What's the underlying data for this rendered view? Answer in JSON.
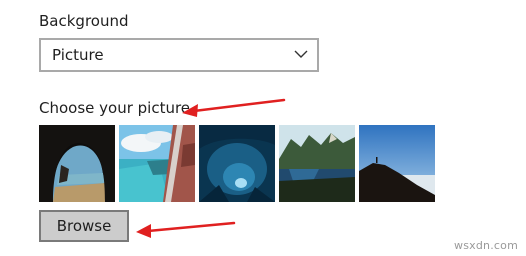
{
  "background_section": {
    "label": "Background",
    "selected_value": "Picture"
  },
  "picture_section": {
    "label": "Choose your picture",
    "thumbnails": [
      {
        "name": "cave-beach-picture"
      },
      {
        "name": "tropical-beach-window-picture"
      },
      {
        "name": "ice-cave-picture"
      },
      {
        "name": "mountain-lake-picture"
      },
      {
        "name": "cliff-sky-picture"
      }
    ]
  },
  "browse_button": {
    "label": "Browse"
  },
  "watermark": {
    "text": "wsxdn.com"
  },
  "colors": {
    "annotation_arrow": "#e02020",
    "button_bg": "#cccccc",
    "dropdown_border": "#a9a9a9"
  }
}
